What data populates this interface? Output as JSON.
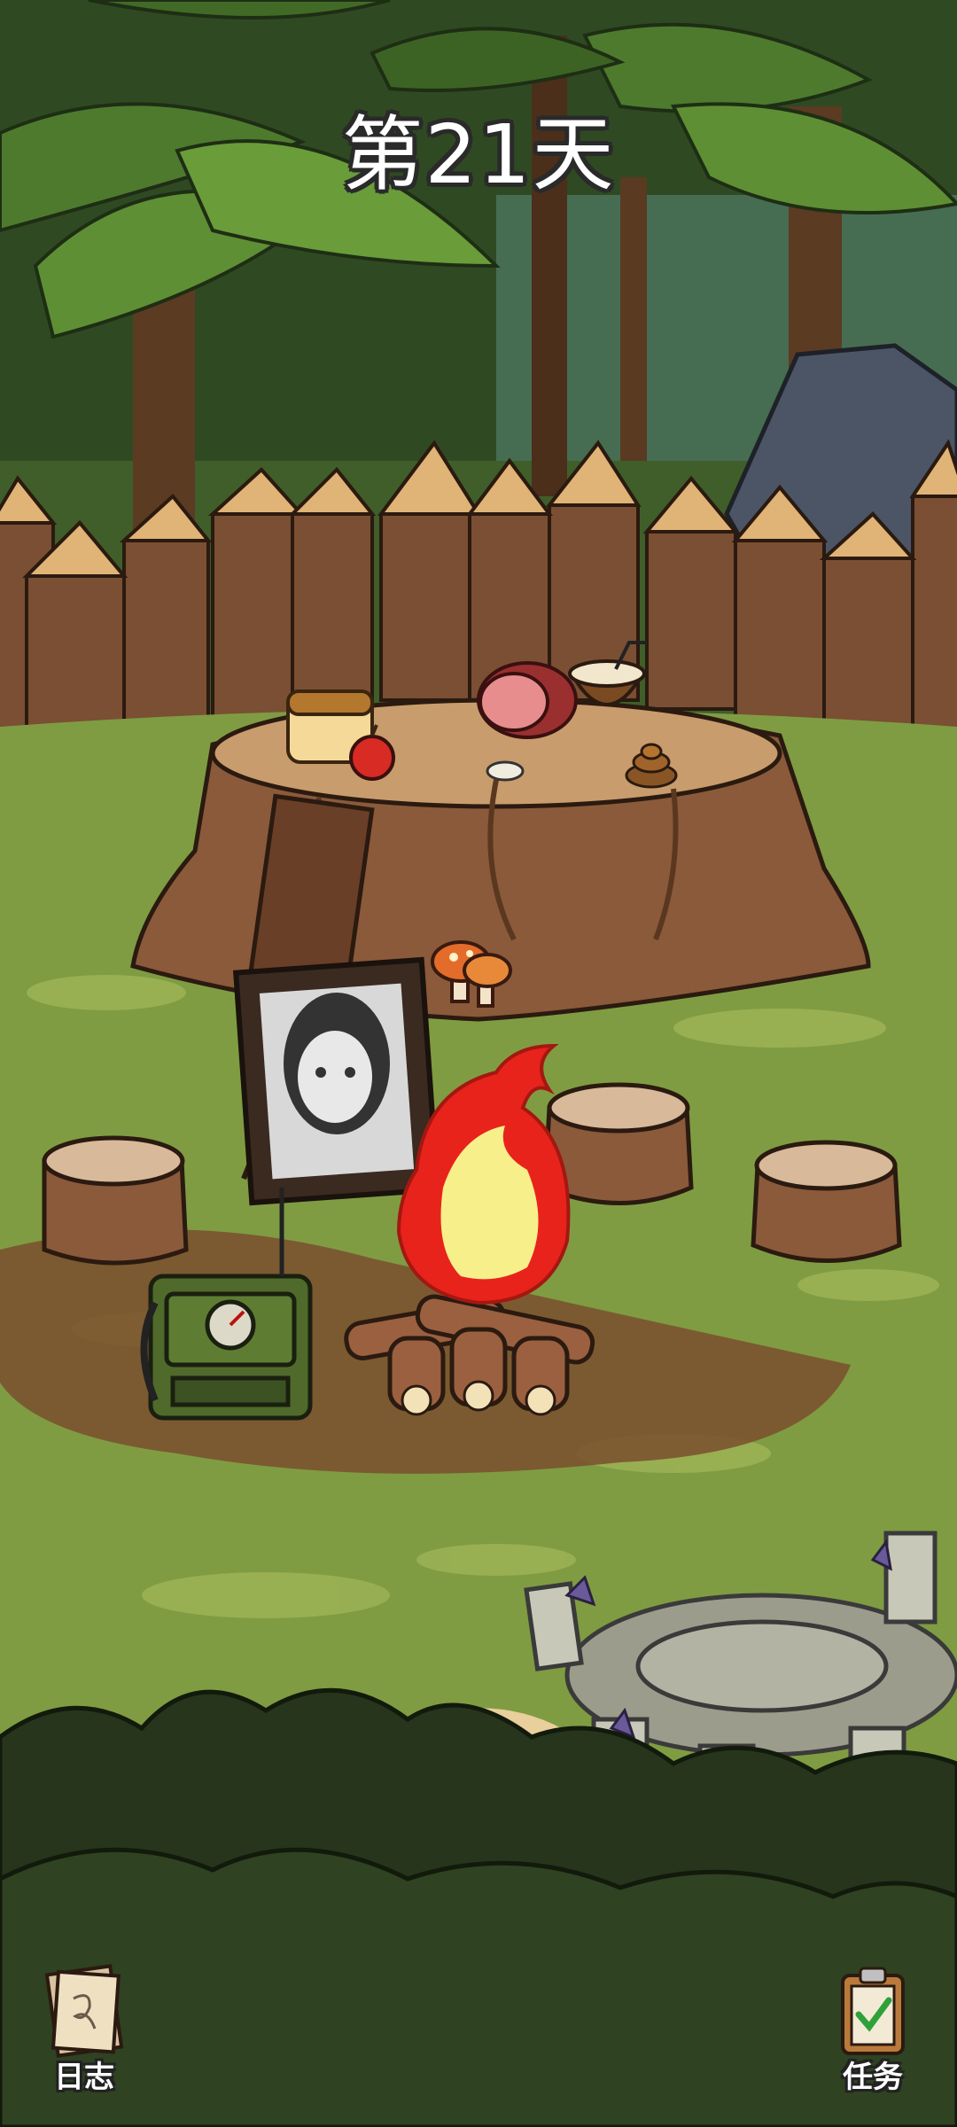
{
  "hud": {
    "day_label": "第21天"
  },
  "buttons": {
    "journal_label": "日志",
    "quests_label": "任务"
  },
  "palette": {
    "grass": "#6f8f3c",
    "grass_light": "#a2b85a",
    "dirt": "#7a4f2e",
    "wood": "#8a5a3b",
    "fire_outer": "#e8231c",
    "fire_inner": "#f7ef8a",
    "bush_dark": "#26351c"
  },
  "scene_objects": [
    "bread-icon",
    "apple-icon",
    "ham-icon",
    "coconut-drink-icon",
    "grub-icon",
    "poop-icon",
    "mushroom-icon",
    "portrait-frame",
    "radio-icon",
    "campfire",
    "stone-well",
    "tree-stump"
  ]
}
